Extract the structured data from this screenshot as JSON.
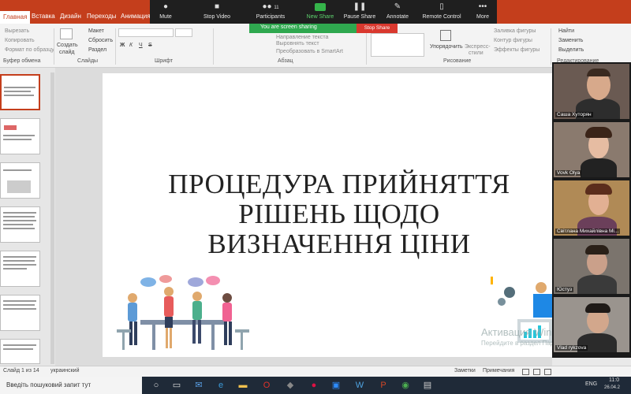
{
  "ppt_tabs": [
    "Главная",
    "Вставка",
    "Дизайн",
    "Переходы",
    "Анимация"
  ],
  "ribbon": {
    "clipboard": {
      "cut": "Вырезать",
      "copy": "Копировать",
      "format": "Формат по образцу",
      "label": "Буфер обмена"
    },
    "slides": {
      "new_slide_1": "Создать",
      "new_slide_2": "слайд",
      "layout": "Макет",
      "reset": "Сбросить",
      "section": "Раздел",
      "label": "Слайды"
    },
    "font": {
      "bold": "Ж",
      "italic": "К",
      "underline": "Ч",
      "strike": "S",
      "label": "Шрифт"
    },
    "paragraph": {
      "direction": "Направление текста",
      "align": "Выровнять текст",
      "smartart": "Преобразовать в SmartArt",
      "label": "Абзац"
    },
    "drawing": {
      "arrange": "Упорядочить",
      "styles_1": "Экспресс-",
      "styles_2": "стили",
      "fill": "Заливка фигуры",
      "outline": "Контур фигуры",
      "effects": "Эффекты фигуры",
      "label": "Рисование"
    },
    "editing": {
      "find": "Найти",
      "replace": "Заменить",
      "select": "Выделить",
      "label": "Редактирование"
    }
  },
  "zoom": {
    "items": [
      {
        "label": "Mute",
        "icon": "mic-icon"
      },
      {
        "label": "Stop Video",
        "icon": "video-icon"
      },
      {
        "label": "Participants",
        "icon": "participants-icon",
        "count": "11"
      },
      {
        "label": "New Share",
        "icon": "share-icon"
      },
      {
        "label": "Pause Share",
        "icon": "pause-icon"
      },
      {
        "label": "Annotate",
        "icon": "pen-icon"
      },
      {
        "label": "Remote Control",
        "icon": "mouse-icon"
      },
      {
        "label": "More",
        "icon": "more-icon"
      }
    ],
    "sharing_text": "You are screen sharing",
    "stop_share": "Stop Share",
    "accent": "#35b44a",
    "stop_color": "#d9382e"
  },
  "slide": {
    "title_lines": [
      "ПРОЦЕДУРА ПРИЙНЯТТЯ",
      "РІШЕНЬ ЩОДО",
      "ВИЗНАЧЕННЯ ЦІНИ"
    ]
  },
  "watermark": {
    "line1": "Активация Windows",
    "line2": "Перейдите в раздел Параметры"
  },
  "participants": [
    {
      "name": "Саша Хуторян"
    },
    {
      "name": "Vovk Olya"
    },
    {
      "name": "Світлана Михайлівна Мі..."
    },
    {
      "name": "Юстуз"
    },
    {
      "name": "Vlad rykzova"
    }
  ],
  "statusbar": {
    "slide_info": "Слайд 1 из 14",
    "language": "украинский",
    "notes": "Заметки",
    "comments": "Примечания"
  },
  "taskbar": {
    "search_placeholder": "Введіть пошуковий запит тут",
    "lang": "ENG",
    "time": "11:0",
    "date": "26.04.2"
  },
  "colors": {
    "ppt_accent": "#c43e1c",
    "zoom_bar": "#1f1f1f",
    "taskbar": "#1f2a38"
  }
}
